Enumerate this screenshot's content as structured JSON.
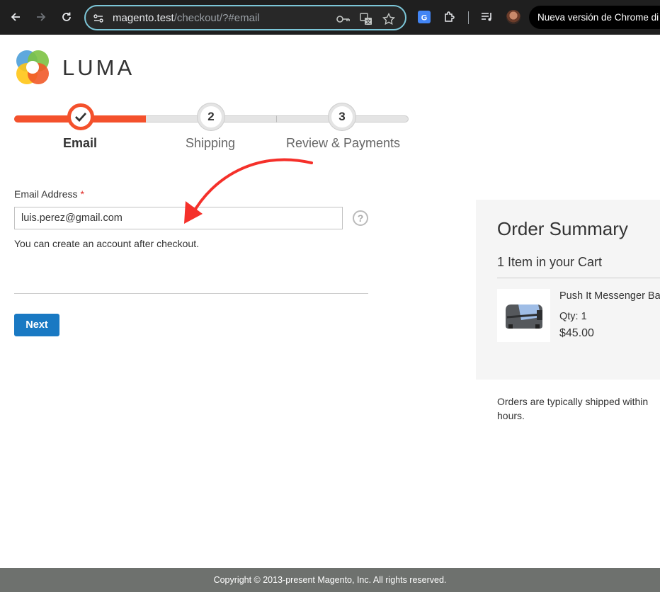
{
  "browser": {
    "url_host": "magento.test",
    "url_path": "/checkout/?#email",
    "update_button": "Nueva versión de Chrome di",
    "colors": {
      "toolbar_bg": "#1f1f1f",
      "omnibox_border": "#7cc6d8"
    }
  },
  "store": {
    "logo_text": "LUMA"
  },
  "progress": {
    "current_step": 1,
    "steps": [
      {
        "label": "Email",
        "number": "",
        "state": "current"
      },
      {
        "label": "Shipping",
        "number": "2",
        "state": "todo"
      },
      {
        "label": "Review & Payments",
        "number": "3",
        "state": "todo"
      }
    ],
    "colors": {
      "active": "#f4512c",
      "inactive": "#e4e4e4"
    }
  },
  "form": {
    "email_label": "Email Address",
    "required_mark": "*",
    "email_value": "luis.perez@gmail.com",
    "help_symbol": "?",
    "note": "You can create an account after checkout.",
    "next_label": "Next",
    "colors": {
      "button": "#1979c3",
      "required": "#e02b27"
    }
  },
  "annotation": {
    "type": "red-arrow",
    "color": "#f5302a",
    "points_to": "email-input"
  },
  "summary": {
    "title": "Order Summary",
    "items_count": "1 Item in your Cart",
    "product": {
      "name": "Push It Messenger Bag",
      "qty": "Qty: 1",
      "price": "$45.00"
    },
    "shipping_note": "Orders are typically shipped within hours."
  },
  "footer": {
    "copyright": "Copyright © 2013-present Magento, Inc. All rights reserved."
  }
}
